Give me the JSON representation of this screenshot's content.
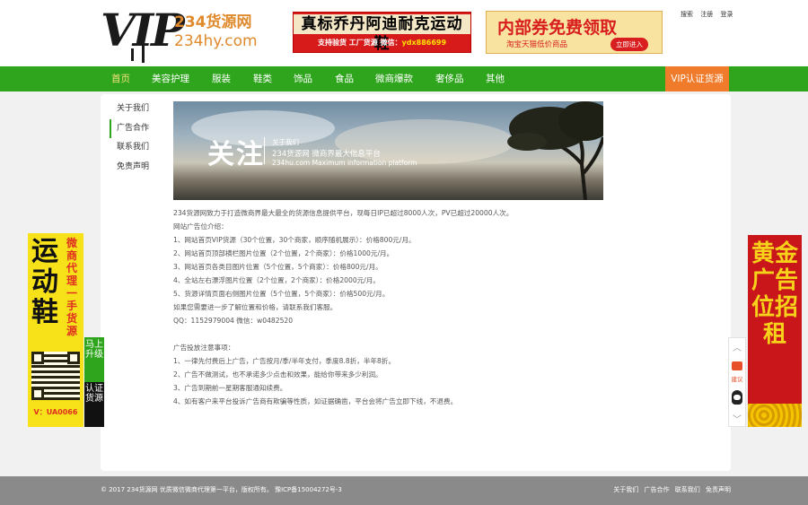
{
  "header": {
    "logo": {
      "mark": "VIP",
      "name": "234货源网",
      "domain": "234hy.com"
    },
    "banner1": {
      "title": "真标乔丹阿迪耐克运动鞋",
      "sub_a": "支持验货  工厂货源 微信：",
      "sub_b": "ydx886699"
    },
    "banner2": {
      "title": "内部券免费领取",
      "sub": "淘宝天猫低价商品",
      "button": "立即进入"
    },
    "top_links": [
      "搜索",
      "注册",
      "登录"
    ]
  },
  "nav": {
    "items": [
      "首页",
      "美容护理",
      "服装",
      "鞋类",
      "饰品",
      "食品",
      "微商爆款",
      "奢侈品",
      "其他"
    ],
    "active_index": 0,
    "vip": "VIP认证货源"
  },
  "side_menu": {
    "items": [
      "关于我们",
      "广告合作",
      "联系我们",
      "免责声明"
    ],
    "active_index": 1
  },
  "hero": {
    "big": "关注",
    "line1": "关于我们",
    "line2": "234货源网 微商界最大信息平台",
    "line3": "234hu.com Maximum information platform"
  },
  "content": {
    "lines": [
      "234货源网致力于打造微商界最大最全的货源信息提供平台，现每日IP已超过8000人次，PV已超过20000人次。",
      "网站广告位介绍：",
      "1、网站首页VIP货源（30个位置，30个商家，顺序随机展示）：价格800元/月。",
      "2、网站首页顶部横栏图片位置（2个位置，2个商家）：价格1000元/月。",
      "3、网站首页各类目图片位置（5个位置，5个商家）：价格800元/月。",
      "4、全站左右漂浮图片位置（2个位置，2个商家）：价格2000元/月。",
      "5、货源详情页面右侧图片位置（5个位置，5个商家）：价格500元/月。",
      "如果您需要进一步了解位置和价格，请联系我们客服。",
      "QQ：1152979004  微信：w0482520",
      "",
      "广告投放注意事项：",
      "1、一律先付费后上广告，广告按月/季/半年支付，季度8.8折，半年8折。",
      "2、广告不做测试，也不承诺多少点击和效果，能给你带来多少利润。",
      "3、广告到期前一星期客服通知续费。",
      "4、如有客户来平台投诉广告商有欺骗等性质，如证据确凿，平台会将广告立即下线，不退费。"
    ]
  },
  "float_left": {
    "big": "运动鞋",
    "side": "微商代理一手货源",
    "id": "V：UA0066",
    "strip_top": "马上升级",
    "strip_bottom": "认证货源"
  },
  "float_right": {
    "text": "黄金广告位招租"
  },
  "side_tools": {
    "up": "︿",
    "feedback": "建议",
    "down": "﹀"
  },
  "footer": {
    "copy": "© 2017 234货源网 优质微信微商代理第一平台，版权所有。 豫ICP备15004272号-3",
    "links": [
      "关于我们",
      "广告合作",
      "联系我们",
      "免责声明"
    ]
  },
  "colors": {
    "green": "#2fa51d",
    "orange": "#f07b2a",
    "footer": "#8a8a8a"
  }
}
